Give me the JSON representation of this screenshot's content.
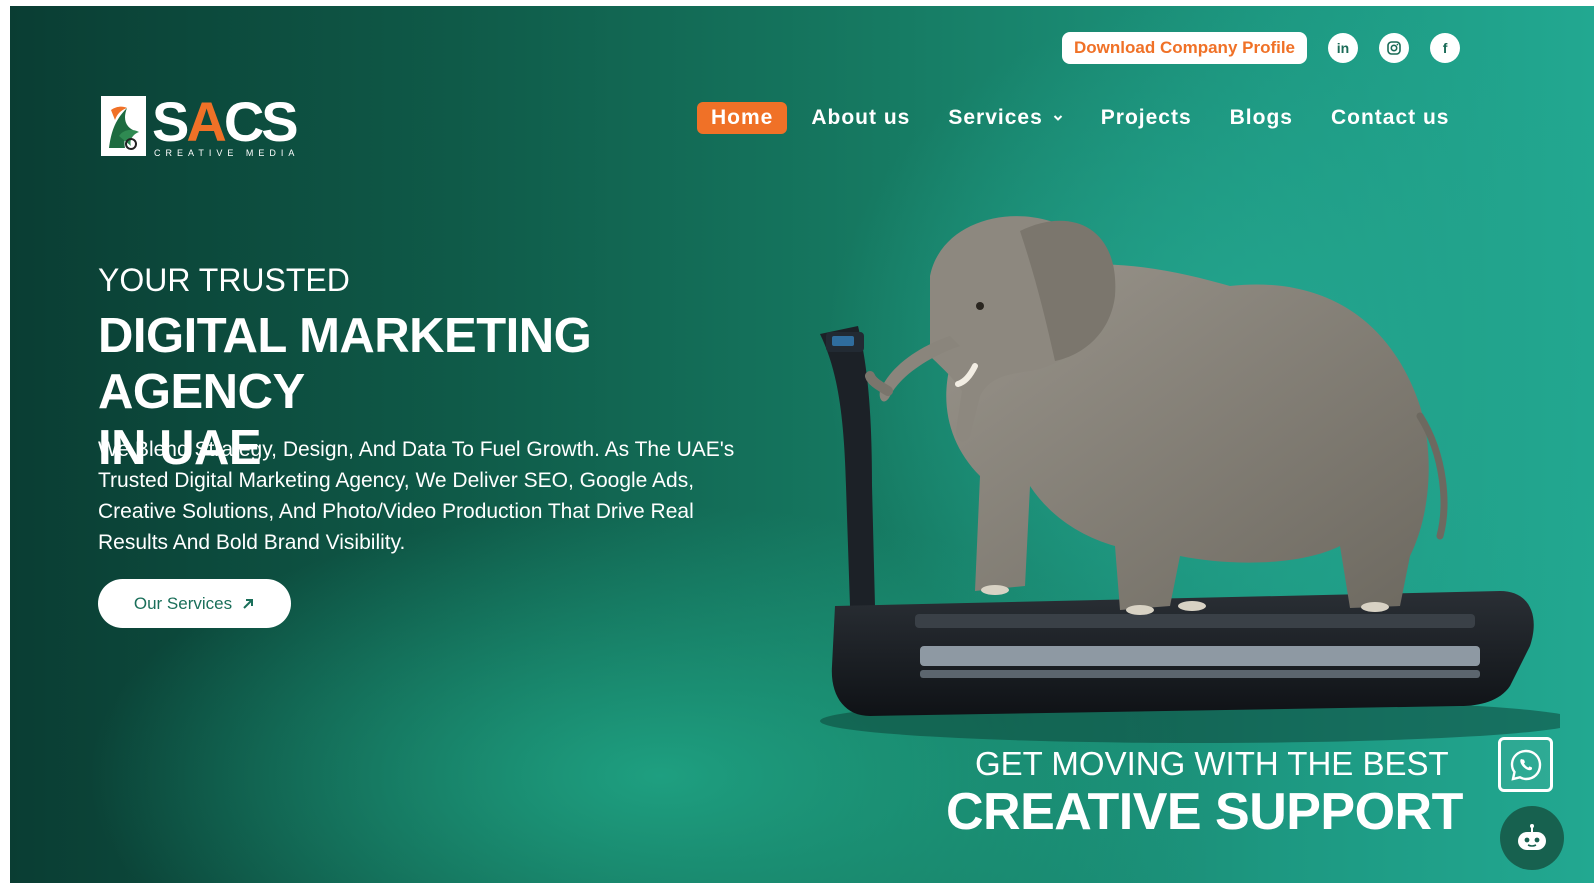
{
  "header": {
    "profile_button": "Download Company Profile",
    "social": [
      {
        "icon": "linkedin-icon",
        "glyph": "in"
      },
      {
        "icon": "instagram-icon"
      },
      {
        "icon": "facebook-icon",
        "glyph": "f"
      }
    ]
  },
  "logo": {
    "word_s": "S",
    "word_a": "A",
    "word_cs": "CS",
    "subtitle": "CREATIVE MEDIA"
  },
  "nav": {
    "home": "Home",
    "about": "About us",
    "services": "Services",
    "projects": "Projects",
    "blogs": "Blogs",
    "contact": "Contact us"
  },
  "hero": {
    "kicker": "YOUR TRUSTED",
    "headline_line1": "DIGITAL MARKETING AGENCY",
    "headline_line2": "IN UAE",
    "description": "We Blend Strategy, Design, And Data To Fuel Growth. As The UAE's Trusted Digital Marketing Agency, We Deliver SEO, Google Ads, Creative Solutions, And Photo/Video Production That Drive Real Results And Bold Brand Visibility.",
    "cta_label": "Our Services"
  },
  "tagline": {
    "small": "GET MOVING WITH THE BEST",
    "big": "CREATIVE SUPPORT"
  },
  "colors": {
    "accent": "#f07127",
    "bg_dark": "#0a3d33",
    "bg_light": "#22a891"
  },
  "floating": {
    "whatsapp_icon": "whatsapp-icon",
    "chatbot_icon": "chatbot-icon"
  }
}
